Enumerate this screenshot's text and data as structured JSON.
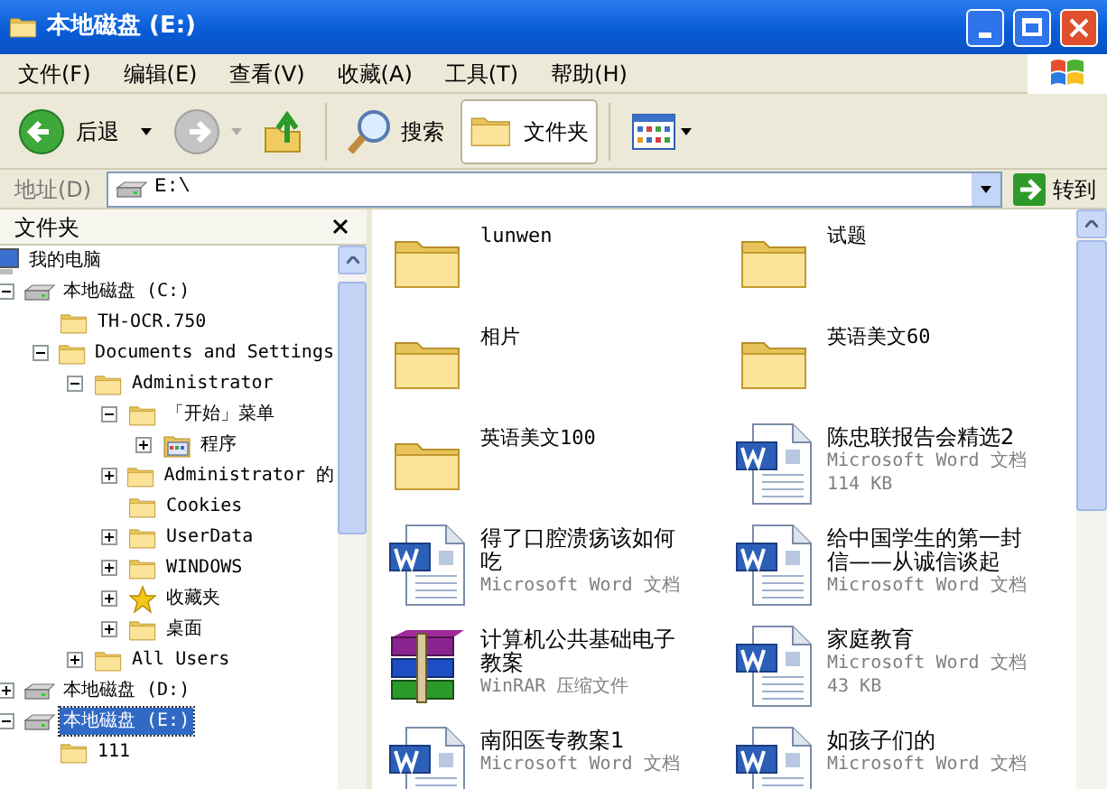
{
  "window": {
    "title": "本地磁盘 (E:)"
  },
  "menu": [
    "文件(F)",
    "编辑(E)",
    "查看(V)",
    "收藏(A)",
    "工具(T)",
    "帮助(H)"
  ],
  "toolbar": [
    {
      "kind": "back",
      "label": "后退",
      "disabled": false
    },
    {
      "kind": "forward",
      "disabled": true
    },
    {
      "kind": "up"
    },
    {
      "kind": "search",
      "label": "搜索",
      "selected": false
    },
    {
      "kind": "folders",
      "label": "文件夹",
      "selected": true
    },
    {
      "kind": "views"
    }
  ],
  "address": {
    "label": "地址(D)",
    "value": "E:\\",
    "go": "转到"
  },
  "folders_pane": {
    "title": "文件夹",
    "tree": [
      {
        "kind": "computer",
        "label": "我的电脑",
        "selected": false,
        "children": [
          {
            "kind": "drive",
            "label": "本地磁盘 (C:)",
            "expanded": true,
            "selected": false,
            "children": [
              {
                "kind": "folder",
                "label": "TH-OCR.750",
                "selected": false
              },
              {
                "kind": "folder",
                "label": "Documents and Settings",
                "expanded": true,
                "selected": false,
                "children": [
                  {
                    "kind": "folder",
                    "label": "Administrator",
                    "expanded": true,
                    "selected": false,
                    "children": [
                      {
                        "kind": "folder",
                        "label": "「开始」菜单",
                        "expanded": true,
                        "selected": false,
                        "children": [
                          {
                            "kind": "programs",
                            "label": "程序",
                            "expanded": false,
                            "selected": false
                          }
                        ]
                      },
                      {
                        "kind": "folder",
                        "label": "Administrator 的",
                        "expanded": false,
                        "selected": false
                      },
                      {
                        "kind": "folder",
                        "label": "Cookies",
                        "selected": false
                      },
                      {
                        "kind": "folder",
                        "label": "UserData",
                        "expanded": false,
                        "selected": false
                      },
                      {
                        "kind": "folder",
                        "label": "WINDOWS",
                        "expanded": false,
                        "selected": false
                      },
                      {
                        "kind": "favorites",
                        "label": "收藏夹",
                        "expanded": false,
                        "selected": false
                      },
                      {
                        "kind": "folder",
                        "label": "桌面",
                        "expanded": false,
                        "selected": false
                      }
                    ]
                  },
                  {
                    "kind": "folder",
                    "label": "All Users",
                    "expanded": false,
                    "selected": false
                  }
                ]
              }
            ]
          },
          {
            "kind": "drive",
            "label": "本地磁盘 (D:)",
            "expanded": false,
            "selected": false
          },
          {
            "kind": "drive",
            "label": "本地磁盘 (E:)",
            "expanded": true,
            "selected": true,
            "children": [
              {
                "kind": "folder",
                "label": "111",
                "selected": false
              }
            ]
          }
        ]
      }
    ]
  },
  "files": [
    {
      "kind": "folder",
      "name": "lunwen"
    },
    {
      "kind": "folder",
      "name": "试题"
    },
    {
      "kind": "folder",
      "name": "相片"
    },
    {
      "kind": "folder",
      "name": "英语美文60"
    },
    {
      "kind": "folder",
      "name": "英语美文100"
    },
    {
      "kind": "word",
      "name": "陈忠联报告会精选2",
      "type": "Microsoft Word 文档",
      "size": "114 KB"
    },
    {
      "kind": "word",
      "name": "得了口腔溃疡该如何吃",
      "type": "Microsoft Word 文档"
    },
    {
      "kind": "word",
      "name": "给中国学生的第一封信——从诚信谈起",
      "type": "Microsoft Word 文档"
    },
    {
      "kind": "rar",
      "name": "计算机公共基础电子教案",
      "type": "WinRAR 压缩文件"
    },
    {
      "kind": "word",
      "name": "家庭教育",
      "type": "Microsoft Word 文档",
      "size": "43 KB"
    },
    {
      "kind": "word",
      "name": "南阳医专教案1",
      "type": "Microsoft Word 文档"
    },
    {
      "kind": "word",
      "name": "如孩子们的",
      "type": "Microsoft Word 文档"
    }
  ]
}
